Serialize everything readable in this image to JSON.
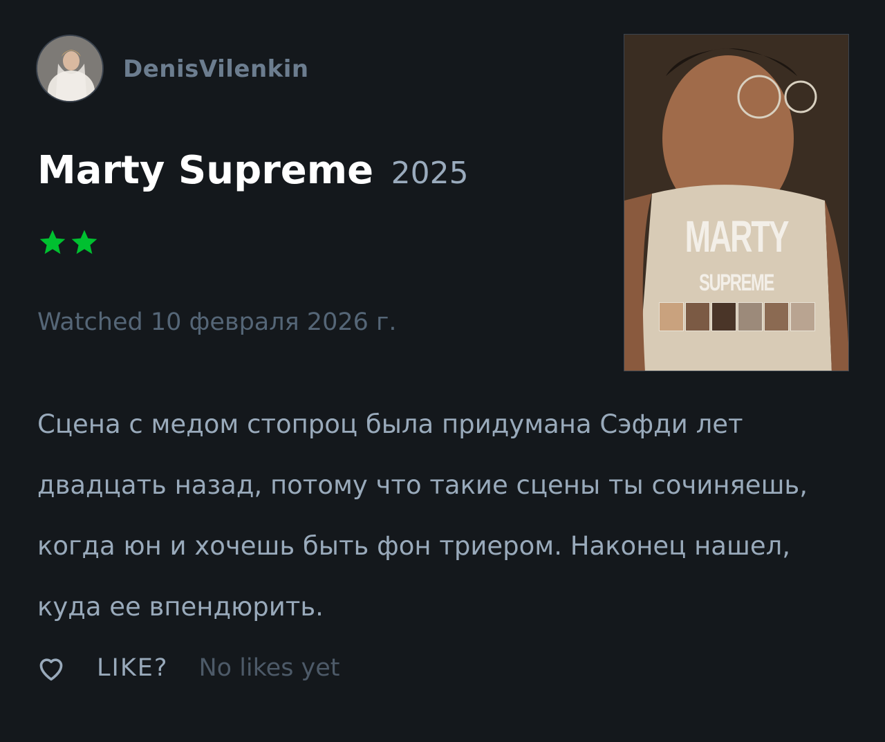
{
  "user": {
    "name": "DenisVilenkin"
  },
  "film": {
    "title": "Marty Supreme",
    "year": "2025"
  },
  "rating": {
    "stars": 2,
    "star_color": "#00c030"
  },
  "watched": "Watched 10 февраля 2026 г.",
  "poster": {
    "title": "MARTY",
    "subtitle": "SUPREME"
  },
  "review": {
    "lines": [
      "Сцена с медом стопроц была придумана Сэфди лет",
      "двадцать назад, потому что такие сцены ты сочиняешь,",
      "когда юн и хочешь быть фон триером. Наконец нашел,",
      "куда ее впендюрить."
    ]
  },
  "like": {
    "label": "LIKE?",
    "count_text": "No likes yet"
  }
}
